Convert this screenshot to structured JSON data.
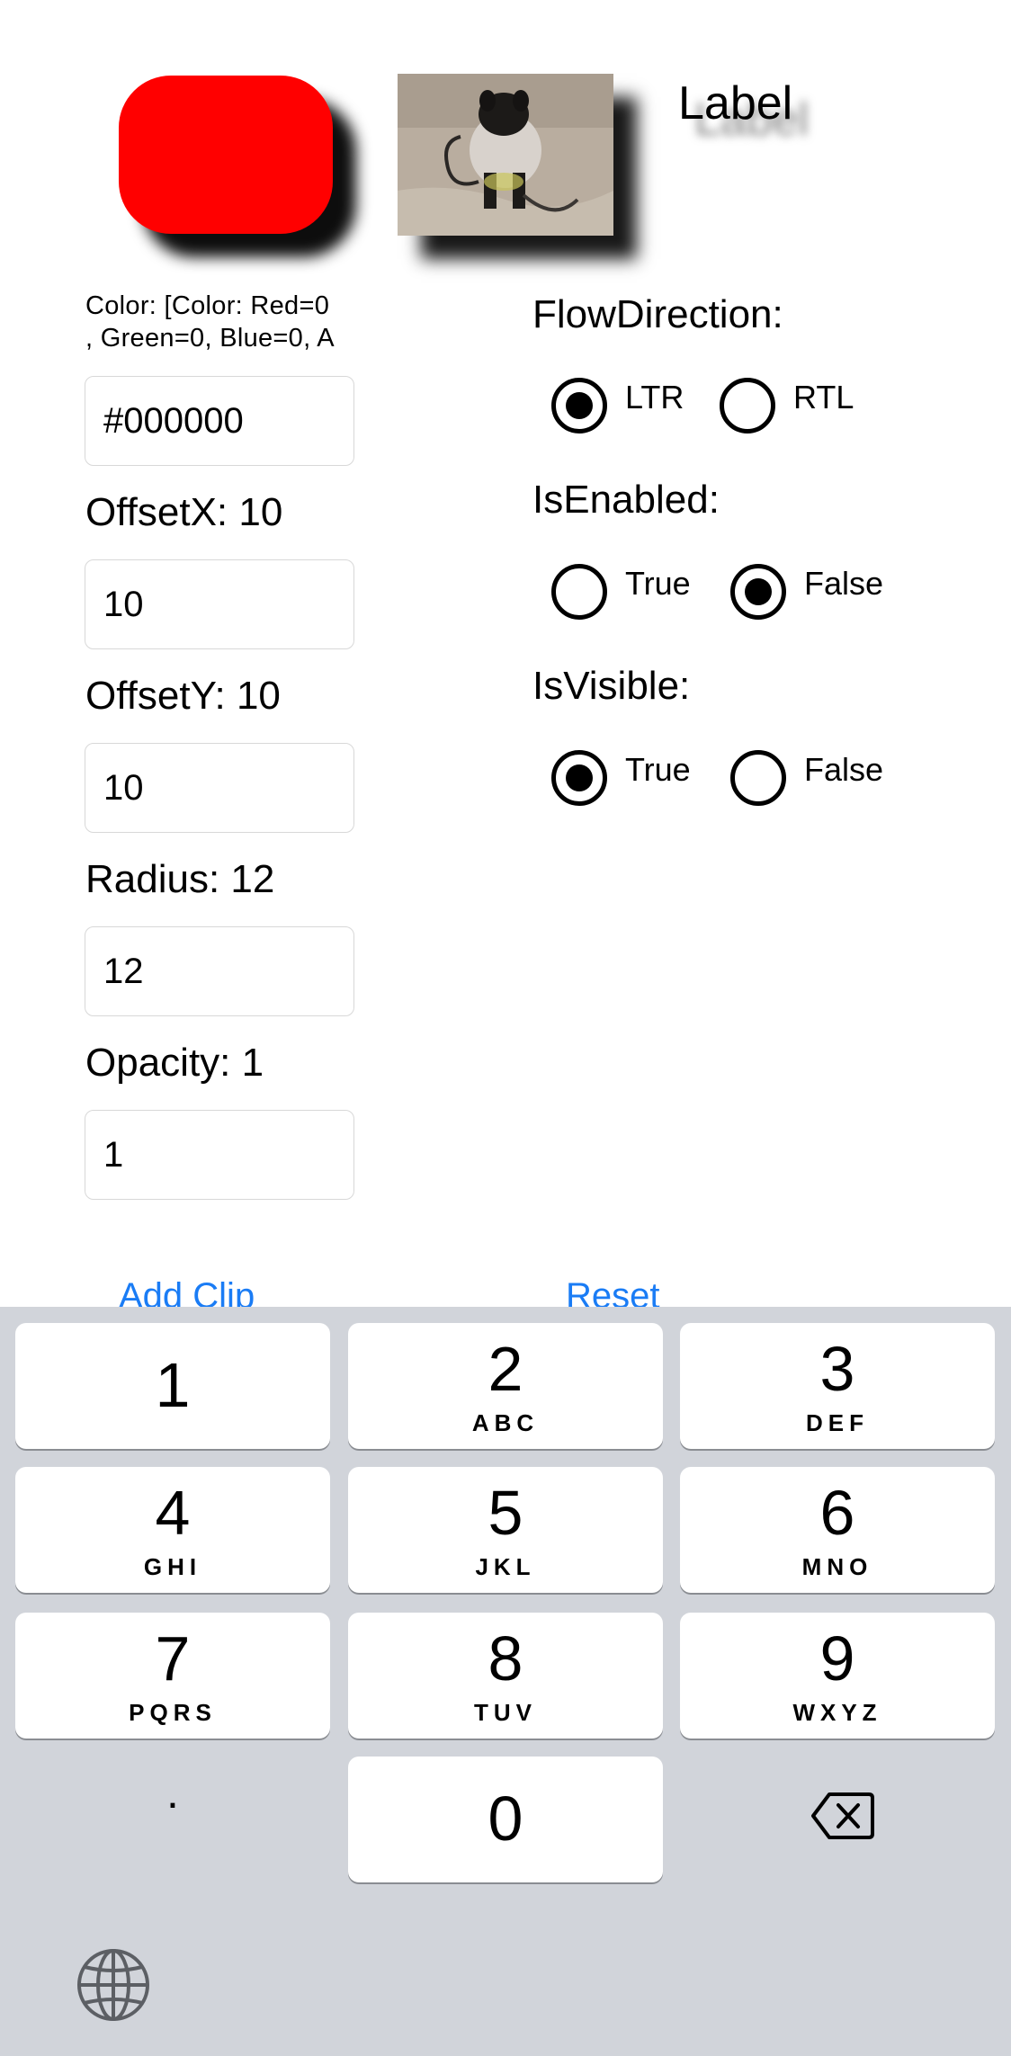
{
  "preview": {
    "label_text": "Label",
    "red_color": "#ff0000"
  },
  "shadow": {
    "color_text": "Color: [Color: Red=0\n, Green=0, Blue=0, A",
    "color_value": "#000000",
    "offset_x_label": "OffsetX: 10",
    "offset_x_value": "10",
    "offset_y_label": "OffsetY: 10",
    "offset_y_value": "10",
    "radius_label": "Radius: 12",
    "radius_value": "12",
    "opacity_label": "Opacity: 1",
    "opacity_value": "1"
  },
  "flow_direction": {
    "label": "FlowDirection:",
    "options": [
      "LTR",
      "RTL"
    ],
    "selected": "LTR"
  },
  "is_enabled": {
    "label": "IsEnabled:",
    "options": [
      "True",
      "False"
    ],
    "selected": "False"
  },
  "is_visible": {
    "label": "IsVisible:",
    "options": [
      "True",
      "False"
    ],
    "selected": "True"
  },
  "actions": {
    "add_clip": "Add Clip",
    "reset": "Reset",
    "accent_color": "#1a7cf5"
  },
  "keyboard": {
    "keys": [
      {
        "digit": "1",
        "letters": ""
      },
      {
        "digit": "2",
        "letters": "ABC"
      },
      {
        "digit": "3",
        "letters": "DEF"
      },
      {
        "digit": "4",
        "letters": "GHI"
      },
      {
        "digit": "5",
        "letters": "JKL"
      },
      {
        "digit": "6",
        "letters": "MNO"
      },
      {
        "digit": "7",
        "letters": "PQRS"
      },
      {
        "digit": "8",
        "letters": "TUV"
      },
      {
        "digit": "9",
        "letters": "WXYZ"
      },
      {
        "digit": "0",
        "letters": ""
      }
    ],
    "dot": ".",
    "delete_icon": "backspace-icon",
    "globe_icon": "globe-icon"
  }
}
